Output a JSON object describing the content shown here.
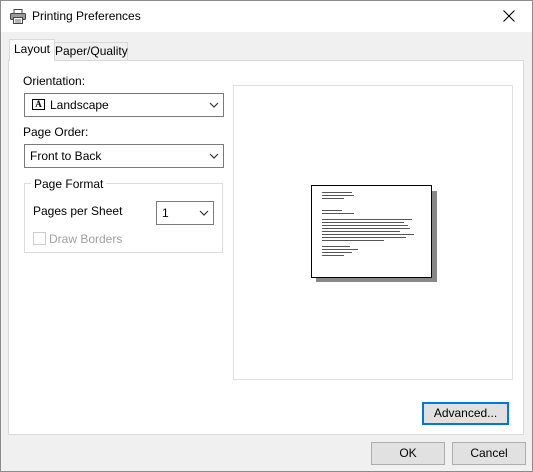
{
  "window": {
    "title": "Printing Preferences"
  },
  "tabs": [
    {
      "label": "Layout",
      "selected": true
    },
    {
      "label": "Paper/Quality",
      "selected": false
    }
  ],
  "layout": {
    "orientation": {
      "label": "Orientation:",
      "value": "Landscape",
      "icon": "landscape-icon",
      "icon_glyph": "A"
    },
    "page_order": {
      "label": "Page Order:",
      "value": "Front to Back"
    },
    "page_format": {
      "legend": "Page Format",
      "pages_per_sheet_label": "Pages per Sheet",
      "pages_per_sheet_value": "1",
      "draw_borders_label": "Draw Borders",
      "draw_borders_checked": false,
      "draw_borders_enabled": false
    },
    "advanced_button": "Advanced..."
  },
  "footer": {
    "ok": "OK",
    "cancel": "Cancel"
  },
  "colors": {
    "dialog_bg": "#f0f0f0",
    "accent_focus": "#0078d7",
    "disabled_text": "#a0a0a0"
  }
}
